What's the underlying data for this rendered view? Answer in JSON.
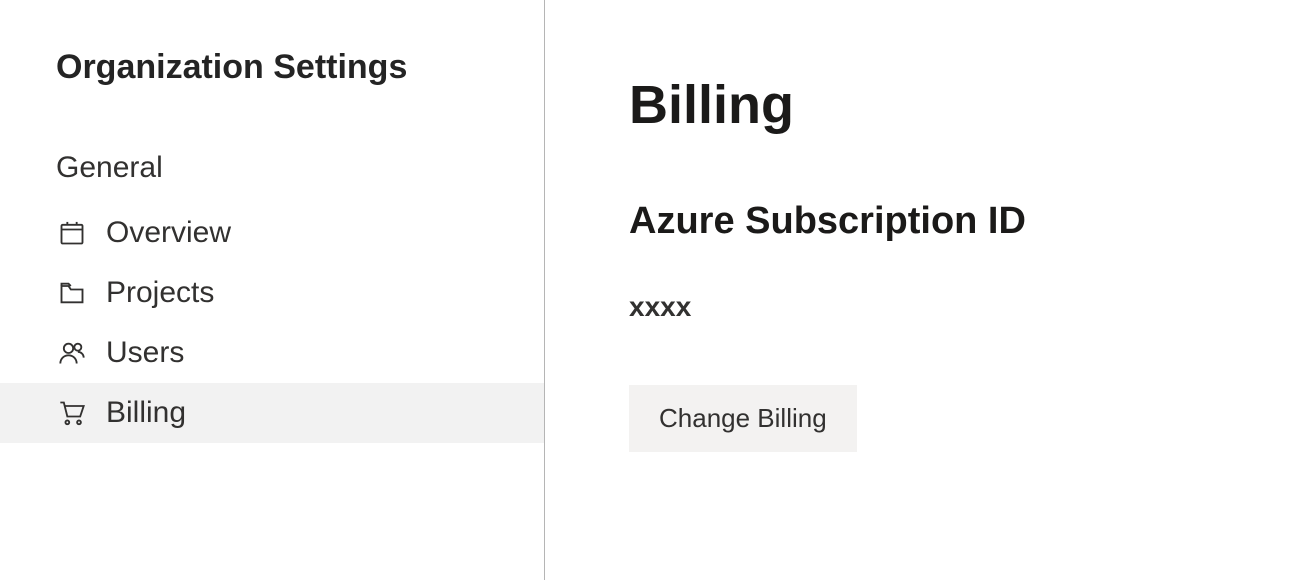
{
  "sidebar": {
    "title": "Organization Settings",
    "section_label": "General",
    "items": [
      {
        "label": "Overview",
        "icon": "overview-icon",
        "selected": false
      },
      {
        "label": "Projects",
        "icon": "projects-icon",
        "selected": false
      },
      {
        "label": "Users",
        "icon": "users-icon",
        "selected": false
      },
      {
        "label": "Billing",
        "icon": "billing-icon",
        "selected": true
      }
    ]
  },
  "main": {
    "title": "Billing",
    "subscription_label": "Azure Subscription ID",
    "subscription_value": "xxxx",
    "change_billing_label": "Change Billing"
  }
}
